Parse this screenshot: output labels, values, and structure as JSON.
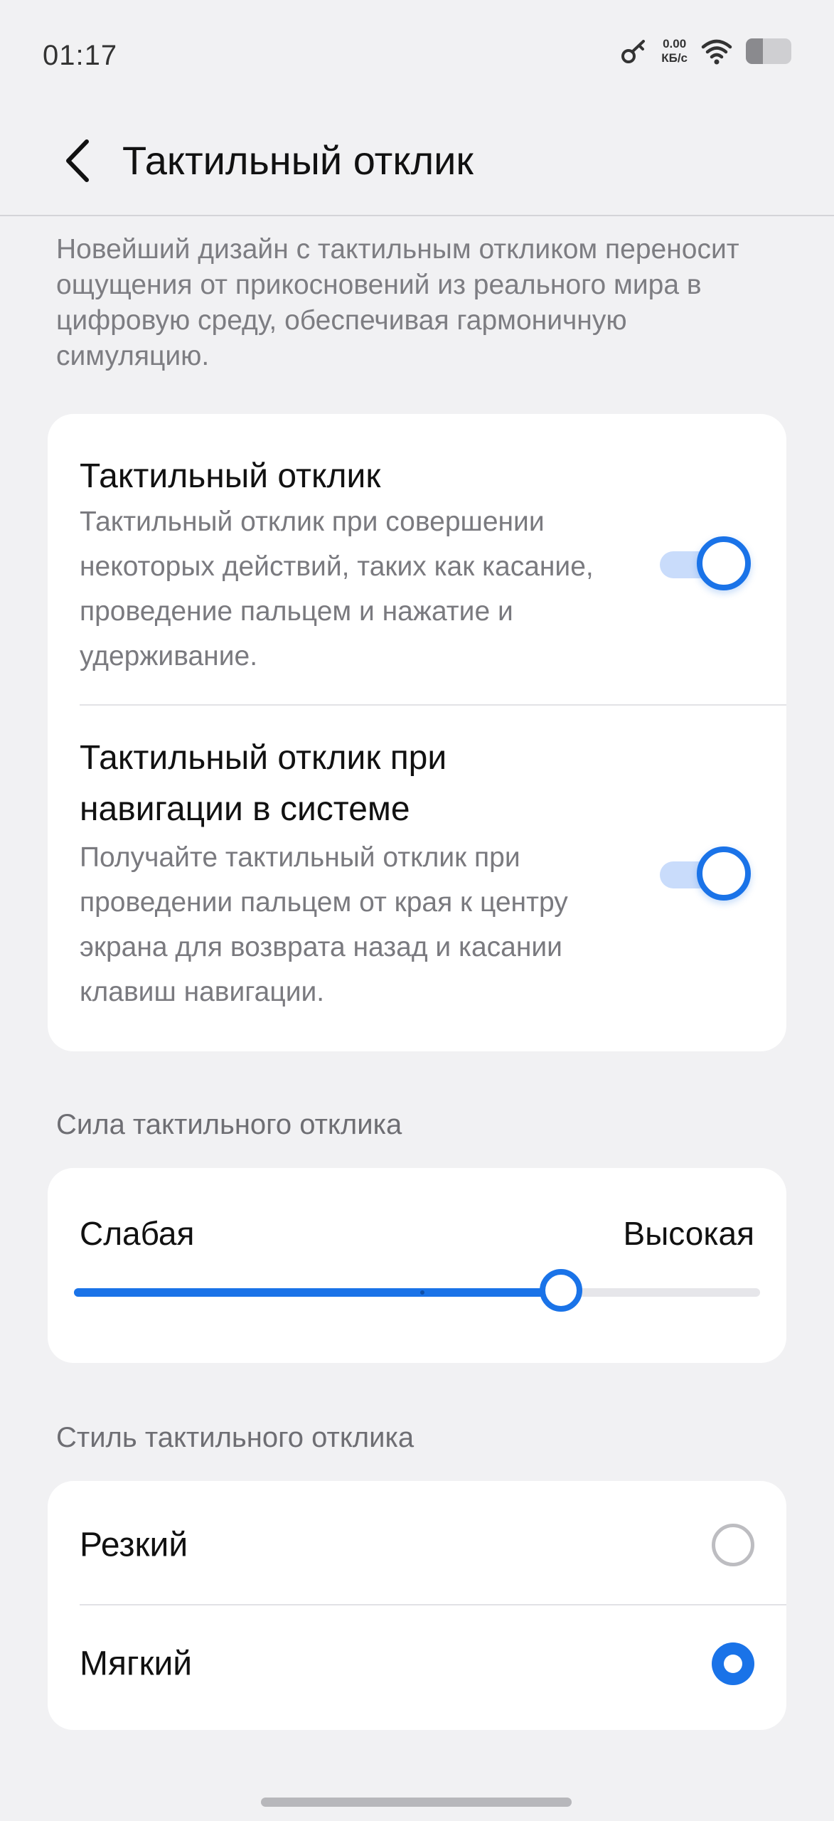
{
  "status_bar": {
    "time": "01:17",
    "net_speed_value": "0.00",
    "net_speed_unit": "КБ/с",
    "icons": [
      "key-icon",
      "wifi-icon",
      "battery-icon"
    ]
  },
  "header": {
    "title": "Тактильный отклик",
    "back_icon": "chevron-left-icon"
  },
  "intro": "Новейший дизайн с тактильным откликом переносит ощущения от прикосновений из реального мира в цифровую среду, обеспечивая гармоничную симуляцию.",
  "toggles": [
    {
      "title": "Тактильный отклик",
      "description": "Тактильный отклик при совершении некоторых действий, таких как касание, проведение пальцем и нажатие и удерживание.",
      "enabled": true
    },
    {
      "title_line1": "Тактильный отклик при",
      "title_line2": "навигации в системе",
      "description": "Получайте тактильный отклик при проведении пальцем от края к центру экрана для возврата назад и касании клавиш навигации.",
      "enabled": true
    }
  ],
  "strength": {
    "header": "Сила тактильного отклика",
    "min_label": "Слабая",
    "max_label": "Высокая",
    "value": 0.71,
    "tick": 0.505
  },
  "style": {
    "header": "Стиль тактильного отклика",
    "options": [
      {
        "label": "Резкий",
        "selected": false
      },
      {
        "label": "Мягкий",
        "selected": true
      }
    ]
  },
  "colors": {
    "accent": "#1a73e8",
    "background": "#f1f1f3",
    "card": "#ffffff"
  }
}
